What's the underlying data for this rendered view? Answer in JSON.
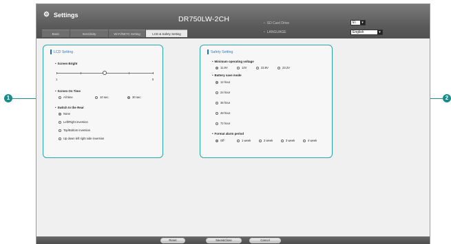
{
  "window": {
    "title": "Settings",
    "model": "DR750LW-2CH"
  },
  "options": {
    "sd_card_label": "SD Card Drive",
    "sd_card_value": "E\\",
    "language_label": "LANGUAGE",
    "language_value": "English"
  },
  "tabs": [
    "Basic",
    "Sensitivity",
    "Wi-Fi/NETC Setting",
    "LCD & Safety Setting"
  ],
  "active_tab_index": 3,
  "lcd": {
    "title": "LCD Setting",
    "brightness": {
      "label": "Screen Bright",
      "min": "1",
      "max": "5",
      "value": 3
    },
    "screen_on_time": {
      "label": "Screen On Time",
      "options": [
        "All time",
        "10 sec.",
        "30 sec."
      ],
      "selected": 2
    },
    "switch_rear": {
      "label": "Switch to the Rear",
      "options": [
        "None",
        "Left/Right inversion",
        "Top/Bottom inversion",
        "Up down left right side inversion"
      ],
      "selected": 0
    }
  },
  "safety": {
    "title": "Safety Setting",
    "min_voltage": {
      "label": "Minimum operating voltage",
      "options": [
        "11.8V",
        "12V",
        "22.8V",
        "23.2V"
      ],
      "selected": 0
    },
    "battery_mode": {
      "label": "Battery save mode",
      "options": [
        "12 hour",
        "24 hour",
        "36 hour",
        "48 hour",
        "72 hour"
      ],
      "selected": 0
    },
    "format_alarm": {
      "label": "Format alarm period",
      "options": [
        "Off",
        "1 week",
        "2 week",
        "3 week",
        "4 week"
      ],
      "selected": 0
    }
  },
  "buttons": {
    "reset": "Reset",
    "save_close": "Save&Close",
    "cancel": "Cancel"
  },
  "callouts": [
    "1",
    "2"
  ],
  "colors": {
    "accent": "#27a8a8",
    "callout": "#168d8d",
    "title_blue": "#3a7abd"
  }
}
